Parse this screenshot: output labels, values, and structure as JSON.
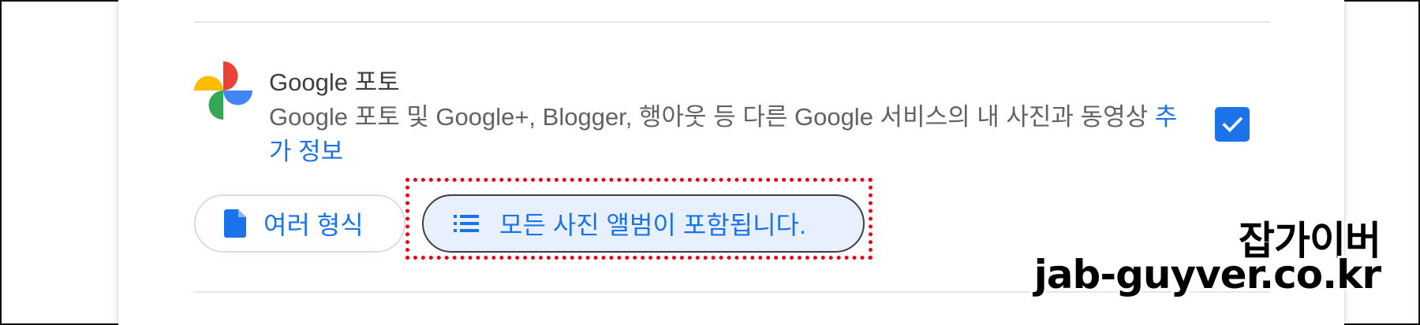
{
  "product": {
    "title": "Google 포토",
    "description": "Google 포토 및 Google+, Blogger, 행아웃 등 다른 Google 서비스의 내 사진과 동영상",
    "more_info_link": "추가 정보",
    "selected": true
  },
  "options": {
    "formats_label": "여러 형식",
    "albums_label": "모든 사진 앨범이 포함됩니다."
  },
  "watermark": {
    "name": "잡가이버",
    "domain": "jab-guyver.co.kr"
  },
  "icons": {
    "logo": "google-photos-pinwheel-icon",
    "checkbox": "check-icon",
    "formats": "document-icon",
    "albums": "list-icon"
  },
  "colors": {
    "accent": "#1a73e8",
    "chip_selected_bg": "#e8f0fe",
    "highlight": "#e8001c",
    "text_primary": "#3c4043",
    "text_secondary": "#5f6368"
  }
}
